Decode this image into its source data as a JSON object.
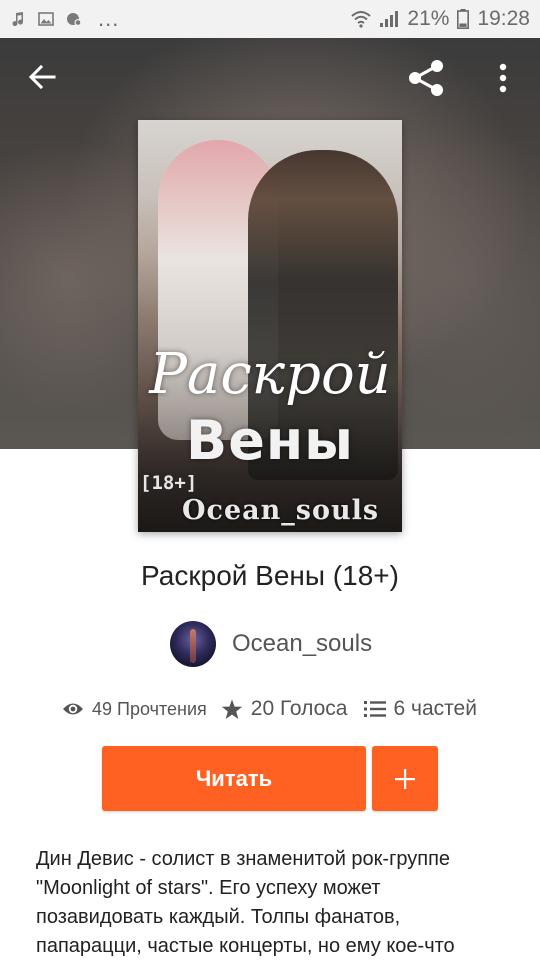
{
  "status_bar": {
    "battery_percent": "21%",
    "time": "19:28",
    "more_indicator": "..."
  },
  "toolbar": {
    "back_icon": "arrow-left-icon",
    "share_icon": "share-icon",
    "more_icon": "vertical-dots-icon"
  },
  "cover": {
    "title_line1": "Раскрой",
    "title_line2": "Вены",
    "age_tag": "[18+]",
    "author": "Ocean_souls"
  },
  "story": {
    "title": "Раскрой Вены (18+)",
    "author": "Ocean_souls",
    "reads": "49 Прочтения",
    "votes": "20 Голоса",
    "parts": "6 частей"
  },
  "actions": {
    "read_label": "Читать",
    "add_label": "+"
  },
  "description": "Дин Девис - солист в знаменитой рок-группе \"Moonlight of stars\". Его успеху может позавидовать каждый. Толпы фанатов, папарацци, частые концерты, но ему кое-что",
  "colors": {
    "accent": "#ff6122",
    "text": "#222222",
    "muted": "#555555"
  }
}
